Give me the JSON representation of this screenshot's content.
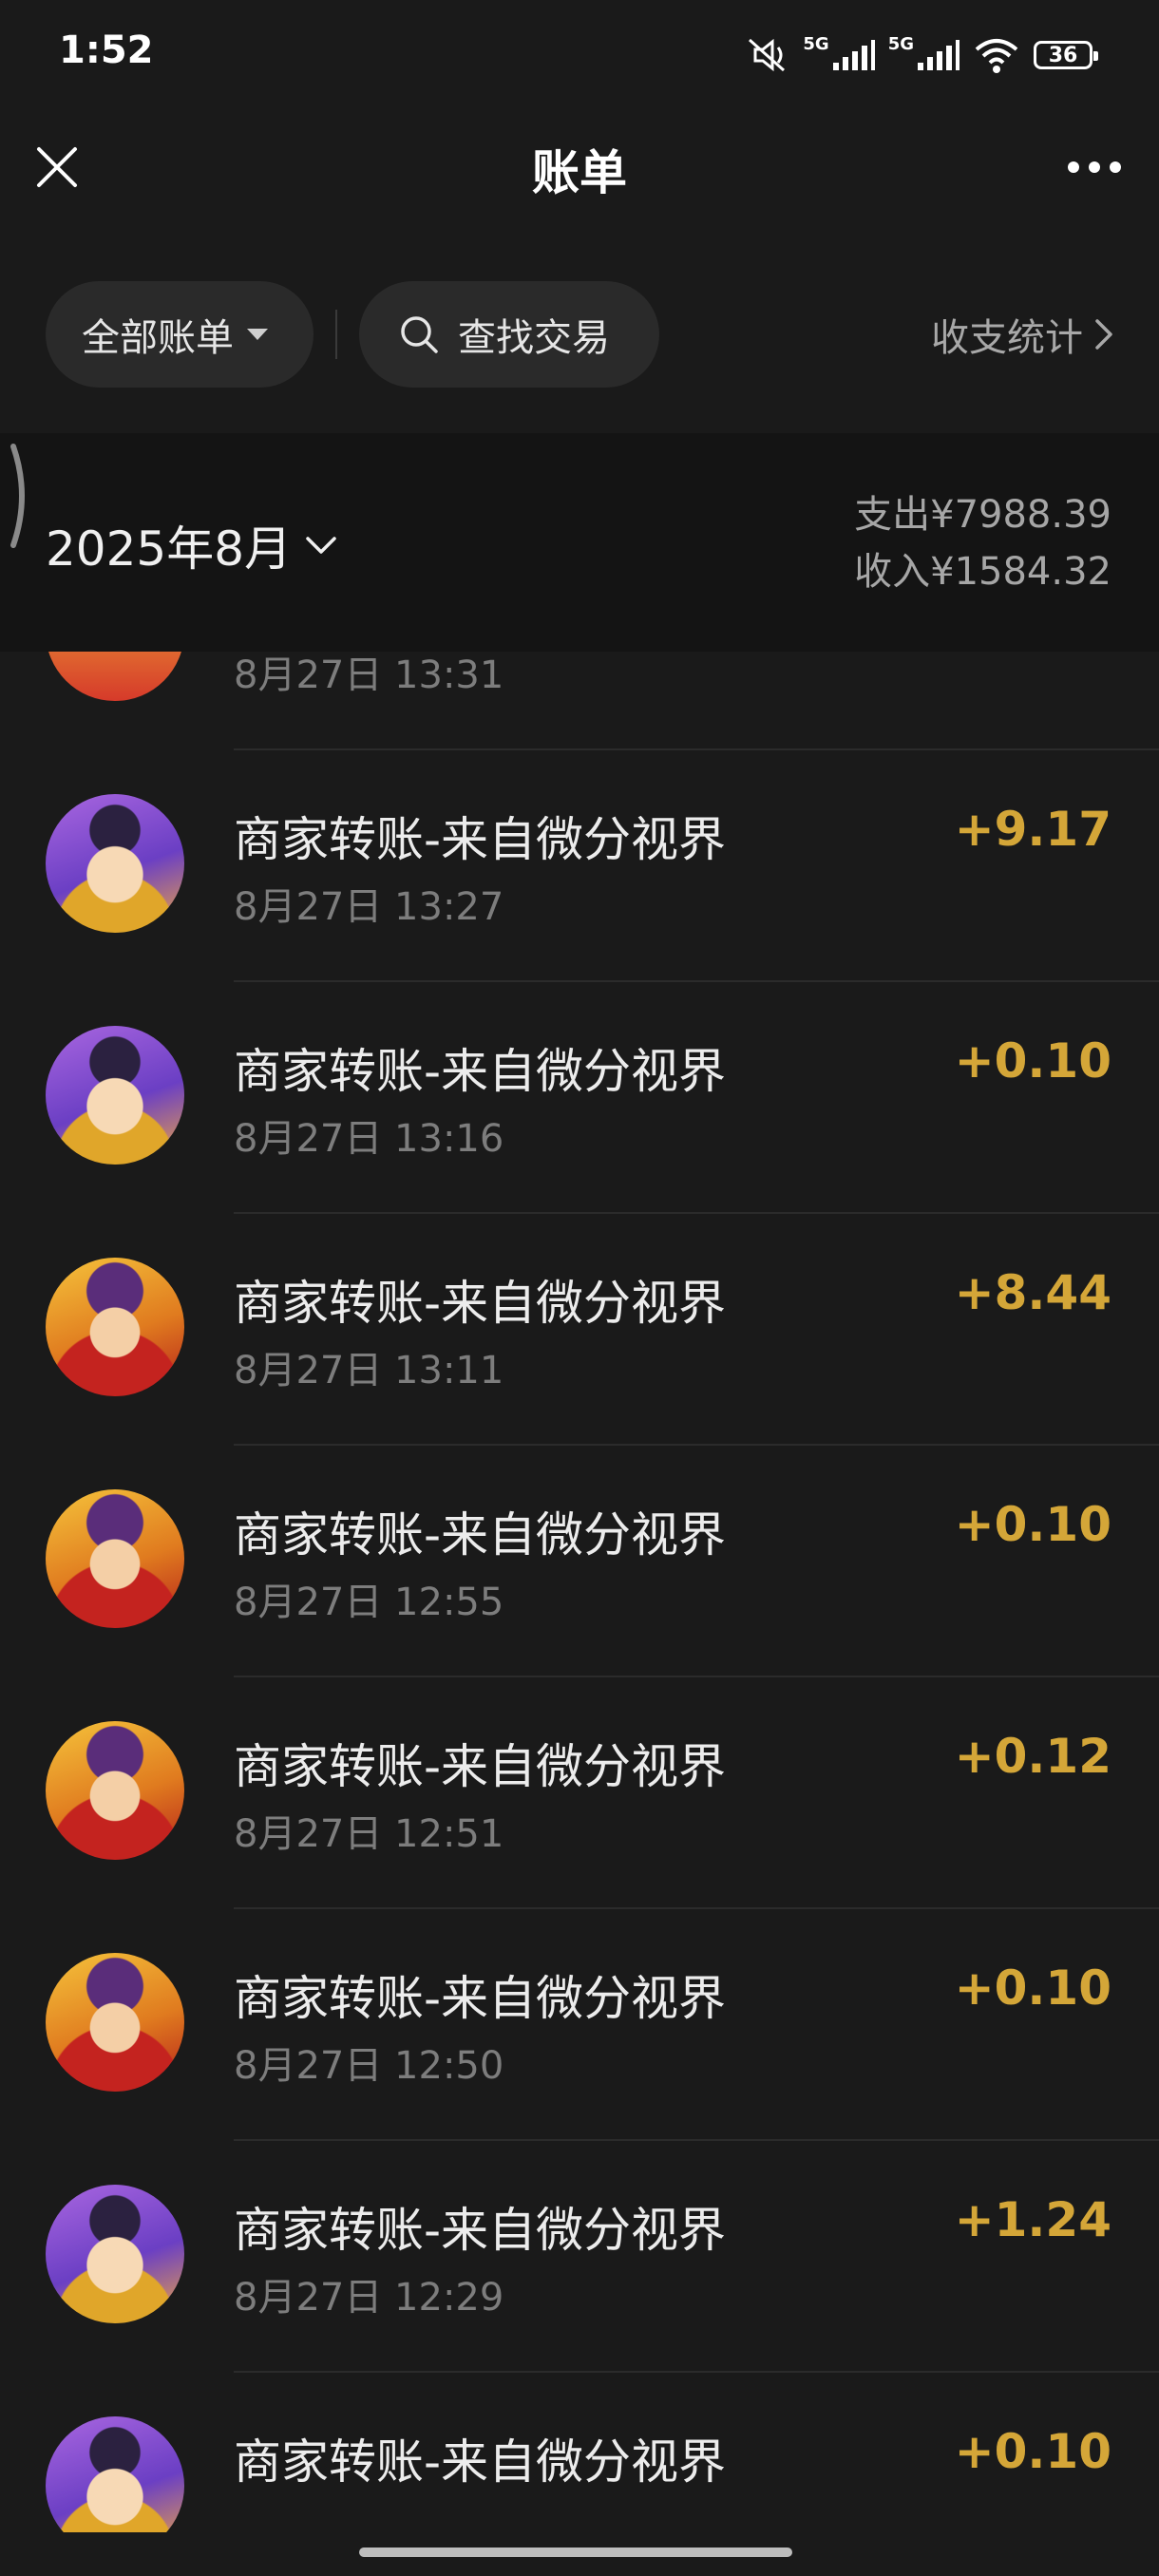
{
  "status_bar": {
    "time": "1:52",
    "network_1": "5G",
    "network_2": "5G",
    "battery": "36"
  },
  "nav": {
    "title": "账单"
  },
  "filters": {
    "all_bills": "全部账单",
    "search": "查找交易",
    "stats": "收支统计"
  },
  "month": {
    "label": "2025年8月",
    "expense": "支出¥7988.39",
    "income": "收入¥1584.32"
  },
  "transactions": [
    {
      "title": "",
      "time": "8月27日 13:31",
      "amount": "",
      "avatar": "fortune"
    },
    {
      "title": "商家转账-来自微分视界",
      "time": "8月27日 13:27",
      "amount": "+9.17",
      "avatar": "god-purple"
    },
    {
      "title": "商家转账-来自微分视界",
      "time": "8月27日 13:16",
      "amount": "+0.10",
      "avatar": "god-purple"
    },
    {
      "title": "商家转账-来自微分视界",
      "time": "8月27日 13:11",
      "amount": "+8.44",
      "avatar": "god-red"
    },
    {
      "title": "商家转账-来自微分视界",
      "time": "8月27日 12:55",
      "amount": "+0.10",
      "avatar": "god-red"
    },
    {
      "title": "商家转账-来自微分视界",
      "time": "8月27日 12:51",
      "amount": "+0.12",
      "avatar": "god-red"
    },
    {
      "title": "商家转账-来自微分视界",
      "time": "8月27日 12:50",
      "amount": "+0.10",
      "avatar": "god-red"
    },
    {
      "title": "商家转账-来自微分视界",
      "time": "8月27日 12:29",
      "amount": "+1.24",
      "avatar": "god-purple"
    },
    {
      "title": "商家转账-来自微分视界",
      "time": "",
      "amount": "+0.10",
      "avatar": "god-purple"
    }
  ],
  "colors": {
    "background": "#1a1a1a",
    "income_amount": "#d4a638",
    "secondary_text": "#7d7d7d"
  },
  "icons": {
    "close": "close-icon",
    "more": "more-icon",
    "search": "search-icon",
    "dropdown": "caret-down-icon",
    "chevron_right": "chevron-right-icon",
    "chevron_down": "chevron-down-icon"
  }
}
